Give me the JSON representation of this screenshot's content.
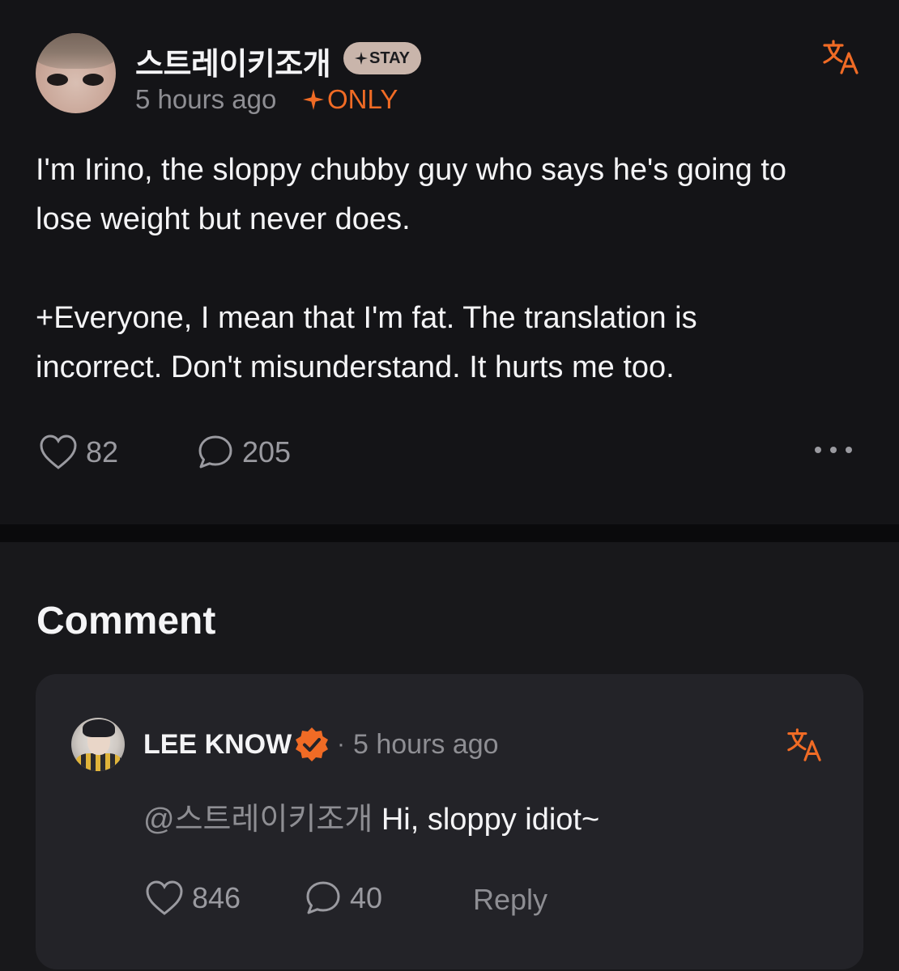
{
  "post": {
    "author": "스트레이키조개",
    "badge": "STAY",
    "time": "5 hours ago",
    "visibility": "ONLY",
    "text": "I'm Irino, the sloppy chubby guy who says he's going to\nlose weight but never does.\n\n+Everyone, I mean that I'm fat. The translation is\nincorrect. Don't misunderstand. It hurts me too.",
    "likes": "82",
    "comments": "205"
  },
  "comment_section": {
    "heading": "Comment",
    "comment": {
      "author": "LEE KNOW",
      "separator": "·",
      "time": "5 hours ago",
      "mention": "@스트레이키조개",
      "text": " Hi, sloppy idiot~",
      "likes": "846",
      "replies": "40",
      "reply_label": "Reply"
    }
  },
  "icons": {
    "translate": "translate-icon",
    "like": "heart-icon",
    "comment": "speech-bubble-icon",
    "more": "more-horizontal-icon",
    "verified": "verified-badge-icon",
    "sparkle": "sparkle-icon"
  },
  "colors": {
    "accent": "#f06b25",
    "background": "#141417",
    "card": "#232328",
    "muted_text": "#8e8e93",
    "badge_bg": "#c9b5ab"
  }
}
